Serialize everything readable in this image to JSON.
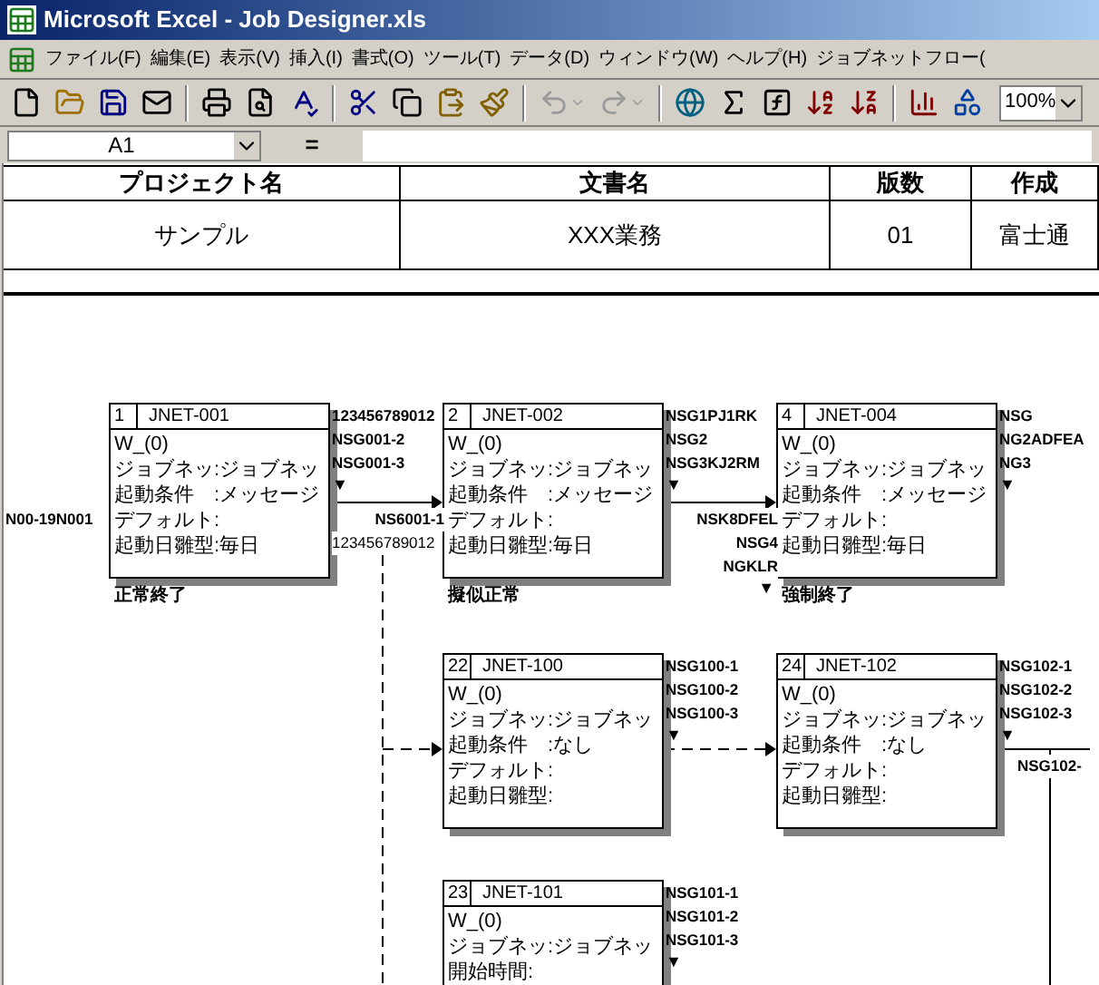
{
  "window": {
    "title": "Microsoft Excel - Job Designer.xls"
  },
  "menu": [
    "ファイル(F)",
    "編集(E)",
    "表示(V)",
    "挿入(I)",
    "書式(O)",
    "ツール(T)",
    "データ(D)",
    "ウィンドウ(W)",
    "ヘルプ(H)",
    "ジョブネットフロー("
  ],
  "toolbar": {
    "buttons": [
      {
        "disabled": false
      },
      {
        "disabled": false
      },
      {
        "disabled": false
      },
      {
        "disabled": false
      },
      {
        "disabled": false
      },
      {
        "disabled": false
      },
      {
        "disabled": false
      },
      {
        "disabled": false
      },
      {
        "disabled": false
      },
      {
        "disabled": false
      },
      {
        "disabled": false
      },
      {
        "disabled": true
      },
      {
        "disabled": true
      },
      {
        "disabled": false
      },
      {
        "disabled": false
      },
      {
        "disabled": false
      },
      {
        "disabled": false
      },
      {
        "disabled": false
      },
      {
        "disabled": false
      },
      {
        "disabled": false
      }
    ],
    "zoom": "100%"
  },
  "formula_bar": {
    "name_box": "A1",
    "equals": "="
  },
  "header_table": {
    "columns": [
      "プロジェクト名",
      "文書名",
      "版数",
      "作成"
    ],
    "values": [
      "サンプル",
      "XXX業務",
      "01",
      "富士通"
    ]
  },
  "flow": {
    "start_label": "N00-19N001",
    "nodes": [
      {
        "number": "1",
        "name": "JNET-001",
        "lines": [
          "W_(0)",
          "ジョブネッ:ジョブネッ",
          "起動条件　:メッセージ",
          "デフォルト:",
          "起動日雛型:毎日"
        ],
        "outputs": [
          "123456789012",
          "NSG001-2",
          "NSG001-3"
        ],
        "marker": "▼",
        "result": "正常終了"
      },
      {
        "number": "2",
        "name": "JNET-002",
        "lines": [
          "W_(0)",
          "ジョブネッ:ジョブネッ",
          "起動条件　:メッセージ",
          "デフォルト:",
          "起動日雛型:毎日"
        ],
        "outputs": [
          "NSG1PJ1RK",
          "NSG2",
          "NSG3KJ2RM"
        ],
        "marker": "▼",
        "result": "擬似正常"
      },
      {
        "number": "4",
        "name": "JNET-004",
        "lines": [
          "W_(0)",
          "ジョブネッ:ジョブネッ",
          "起動条件　:メッセージ",
          "デフォルト:",
          "起動日雛型:毎日"
        ],
        "outputs": [
          "NSG",
          "NG2ADFEA",
          "NG3"
        ],
        "marker": "▼",
        "result": "強制終了"
      },
      {
        "number": "22",
        "name": "JNET-100",
        "lines": [
          "W_(0)",
          "ジョブネッ:ジョブネッ",
          "起動条件　:なし",
          "デフォルト:",
          "起動日雛型:"
        ],
        "outputs": [
          "NSG100-1",
          "NSG100-2",
          "NSG100-3"
        ],
        "marker": "▼"
      },
      {
        "number": "24",
        "name": "JNET-102",
        "lines": [
          "W_(0)",
          "ジョブネッ:ジョブネッ",
          "起動条件　:なし",
          "デフォルト:",
          "起動日雛型:"
        ],
        "outputs": [
          "NSG102-1",
          "NSG102-2",
          "NSG102-3"
        ],
        "marker": "▼"
      },
      {
        "number": "23",
        "name": "JNET-101",
        "lines": [
          "W_(0)",
          "ジョブネッ:ジョブネッ",
          "開始時間:"
        ],
        "outputs": [
          "NSG101-1",
          "NSG101-2",
          "NSG101-3"
        ],
        "marker": "▼"
      }
    ],
    "connectors": [
      {
        "kind": "solid",
        "labels": [
          "NS6001-1",
          "123456789012"
        ]
      },
      {
        "kind": "solid",
        "labels": [
          "NSK8DFEL",
          "NSG4",
          "NGKLR"
        ],
        "marker": "▼"
      },
      {
        "kind": "dashed"
      },
      {
        "kind": "dashed"
      },
      {
        "kind": "solid",
        "labels": [
          "NSG102-"
        ]
      }
    ]
  }
}
